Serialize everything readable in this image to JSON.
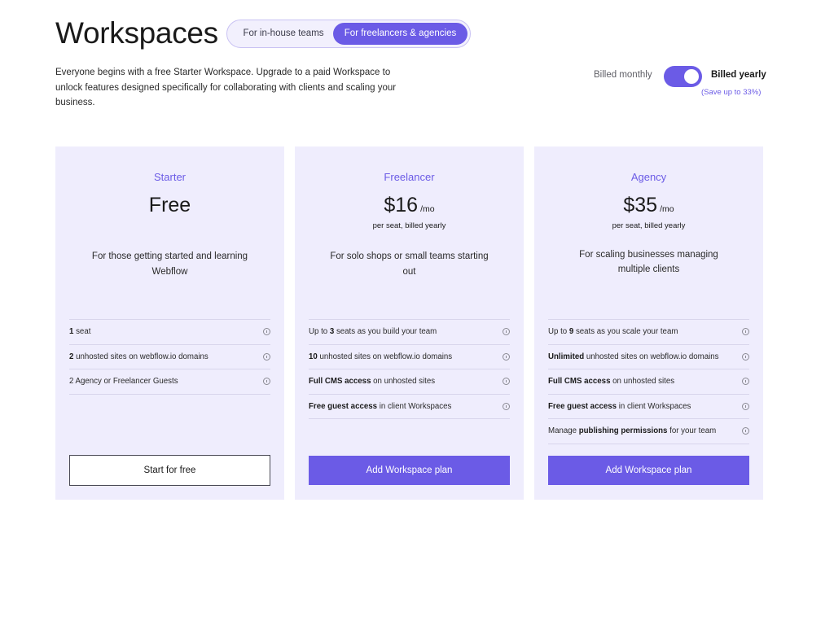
{
  "page": {
    "title": "Workspaces",
    "audience_tabs": [
      "For in-house teams",
      "For freelancers & agencies"
    ],
    "intro": "Everyone begins with a free Starter Workspace. Upgrade to a paid Workspace to unlock features designed specifically for collaborating with clients and scaling your business."
  },
  "billing": {
    "monthly_label": "Billed monthly",
    "yearly_label": "Billed yearly",
    "save_note": "(Save up to 33%)",
    "yearly_selected": true
  },
  "colors": {
    "accent": "#6b5be6",
    "card_bg": "#efedfd"
  },
  "plans": [
    {
      "name": "Starter",
      "price": "Free",
      "per": "",
      "sub": "",
      "desc": "For those getting started and learning Webflow",
      "features": [
        {
          "strong": "1",
          "rest": " seat"
        },
        {
          "strong": "2",
          "rest": " unhosted sites on webflow.io domains"
        },
        {
          "strong": "",
          "rest": "2 Agency or Freelancer Guests"
        }
      ],
      "cta": "Start for free"
    },
    {
      "name": "Freelancer",
      "price": "$16",
      "per": "/mo",
      "sub": "per seat, billed yearly",
      "desc": "For solo shops or small teams starting out",
      "features": [
        {
          "pre": "Up to ",
          "strong": "3",
          "rest": " seats as you build your team"
        },
        {
          "strong": "10",
          "rest": " unhosted sites on webflow.io domains"
        },
        {
          "strong": "Full CMS access",
          "rest": " on unhosted sites"
        },
        {
          "strong": "Free guest access",
          "rest": " in client Workspaces"
        }
      ],
      "cta": "Add Workspace plan"
    },
    {
      "name": "Agency",
      "price": "$35",
      "per": "/mo",
      "sub": "per seat, billed yearly",
      "desc": "For scaling businesses managing multiple clients",
      "features": [
        {
          "pre": "Up to ",
          "strong": "9",
          "rest": " seats as you scale your team"
        },
        {
          "strong": "Unlimited",
          "rest": " unhosted sites on webflow.io domains"
        },
        {
          "strong": "Full CMS access",
          "rest": " on unhosted sites"
        },
        {
          "strong": "Free guest access",
          "rest": " in client Workspaces"
        },
        {
          "pre": "Manage ",
          "strong": "publishing permissions",
          "rest": " for your team"
        }
      ],
      "cta": "Add Workspace plan"
    }
  ]
}
